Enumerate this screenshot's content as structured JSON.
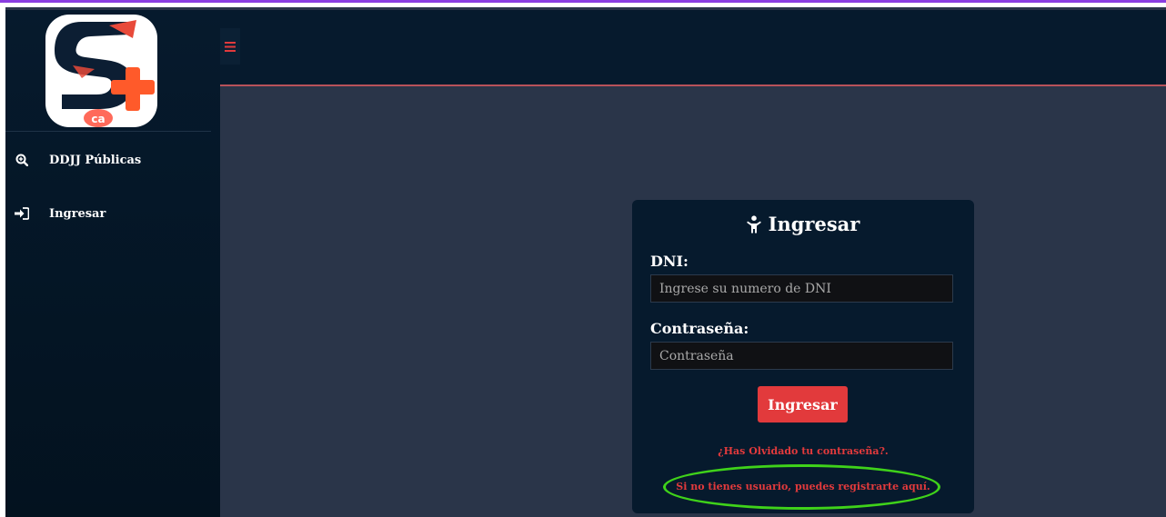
{
  "sidebar": {
    "logo_alt": "S+ logo",
    "items": [
      {
        "label": "DDJJ Públicas",
        "icon": "search-plus-icon"
      },
      {
        "label": "Ingresar",
        "icon": "sign-in-icon"
      }
    ]
  },
  "header": {
    "menu_icon": "hamburger-icon"
  },
  "login": {
    "title": "Ingresar",
    "title_icon": "child-icon",
    "dni_label": "DNI:",
    "dni_placeholder": "Ingrese su numero de DNI",
    "password_label": "Contraseña:",
    "password_placeholder": "Contraseña",
    "submit_label": "Ingresar",
    "forgot_link": "¿Has Olvidado tu contraseña?.",
    "register_link": "Si no tienes usuario, puedes registrarte aquí."
  },
  "colors": {
    "accent": "#e23a3c",
    "sidebar_bg": "#061a2d",
    "content_bg": "#2a3549",
    "highlight": "#3fd21a"
  }
}
